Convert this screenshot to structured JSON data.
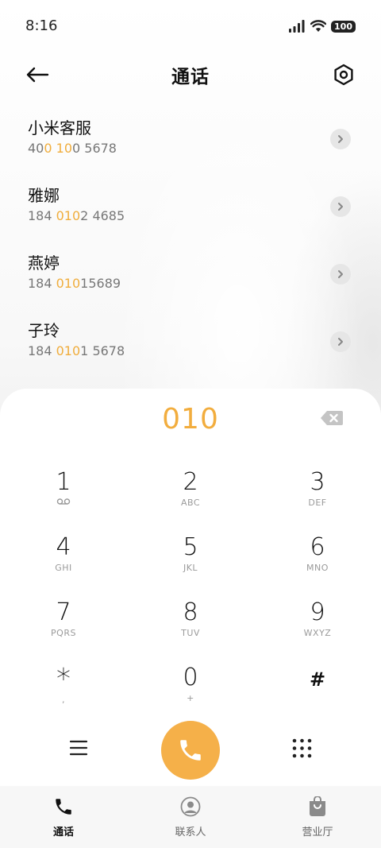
{
  "status_bar": {
    "time": "8:16",
    "battery": "100"
  },
  "header": {
    "title": "通话"
  },
  "contacts": [
    {
      "name": "小米客服",
      "number_parts": [
        "40",
        "0",
        " ",
        "10",
        "0 5678"
      ]
    },
    {
      "name": "雅娜",
      "number_parts": [
        "184 ",
        "010",
        "2 4685"
      ]
    },
    {
      "name": "燕婷",
      "number_parts": [
        "184 ",
        "010",
        "15689"
      ]
    },
    {
      "name": "子玲",
      "number_parts": [
        "184 ",
        "010",
        "1 5678"
      ]
    }
  ],
  "dialpad": {
    "number": "010",
    "keys": [
      {
        "digit": "1",
        "letters": ""
      },
      {
        "digit": "2",
        "letters": "ABC"
      },
      {
        "digit": "3",
        "letters": "DEF"
      },
      {
        "digit": "4",
        "letters": "GHI"
      },
      {
        "digit": "5",
        "letters": "JKL"
      },
      {
        "digit": "6",
        "letters": "MNO"
      },
      {
        "digit": "7",
        "letters": "PQRS"
      },
      {
        "digit": "8",
        "letters": "TUV"
      },
      {
        "digit": "9",
        "letters": "WXYZ"
      },
      {
        "digit": "*",
        "letters": ","
      },
      {
        "digit": "0",
        "letters": "+"
      },
      {
        "digit": "#",
        "letters": ""
      }
    ]
  },
  "bottom_nav": [
    {
      "label": "通话",
      "icon": "phone-icon",
      "active": true
    },
    {
      "label": "联系人",
      "icon": "person-icon",
      "active": false
    },
    {
      "label": "营业厅",
      "icon": "shopping-bag-icon",
      "active": false
    }
  ],
  "colors": {
    "accent": "#f2ad3e",
    "call_button": "#f5b049"
  }
}
